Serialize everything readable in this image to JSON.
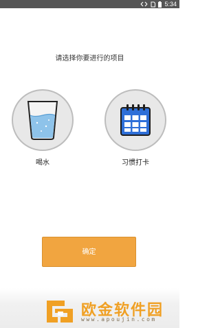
{
  "status_bar": {
    "time": "5:34"
  },
  "prompt": "请选择你要进行的项目",
  "options": [
    {
      "label": "喝水"
    },
    {
      "label": "习惯打卡"
    }
  ],
  "confirm_label": "确定",
  "watermark": {
    "title": "欧金软件园",
    "url": "www.apoujin.com"
  },
  "colors": {
    "accent": "#f1a540",
    "circle": "#e8e8e8",
    "calendar_blue": "#2e6fd8"
  }
}
